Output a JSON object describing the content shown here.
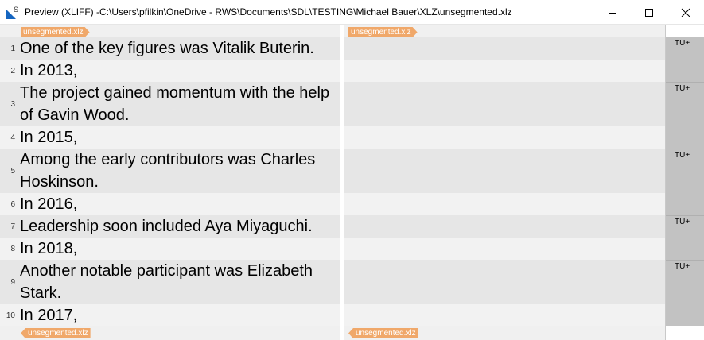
{
  "window": {
    "title": "Preview (XLIFF) -C:\\Users\\pfilkin\\OneDrive - RWS\\Documents\\SDL\\TESTING\\Michael Bauer\\XLZ\\unsegmented.xlz",
    "app_icon": "sdl-app-icon",
    "icon_letter": "S",
    "controls": [
      "minimize-icon",
      "maximize-icon",
      "close-icon"
    ]
  },
  "tags": {
    "source_open": "unsegmented.xlz",
    "target_open": "unsegmented.xlz",
    "source_close": "unsegmented.xlz",
    "target_close": "unsegmented.xlz"
  },
  "segments": [
    {
      "num": "1",
      "text": "One of the key figures was Vitalik Buterin."
    },
    {
      "num": "2",
      "text": "In 2013,"
    },
    {
      "num": "3",
      "text": "The project gained momentum with the help of Gavin Wood."
    },
    {
      "num": "4",
      "text": "In 2015,"
    },
    {
      "num": "5",
      "text": "Among the early contributors was Charles Hoskinson."
    },
    {
      "num": "6",
      "text": "In 2016,"
    },
    {
      "num": "7",
      "text": "Leadership soon included Aya Miyaguchi."
    },
    {
      "num": "8",
      "text": "In 2018,"
    },
    {
      "num": "9",
      "text": "Another notable participant was Elizabeth Stark."
    },
    {
      "num": "10",
      "text": "In 2017,"
    }
  ],
  "tu_labels": [
    "TU+",
    "TU+",
    "TU+",
    "TU+",
    "TU+"
  ],
  "colors": {
    "tag": "#f0a86a",
    "row_dark": "#e6e6e6",
    "row_light": "#f2f2f2",
    "tu_block": "#c2c2c2",
    "icon_blue": "#1565c0"
  }
}
